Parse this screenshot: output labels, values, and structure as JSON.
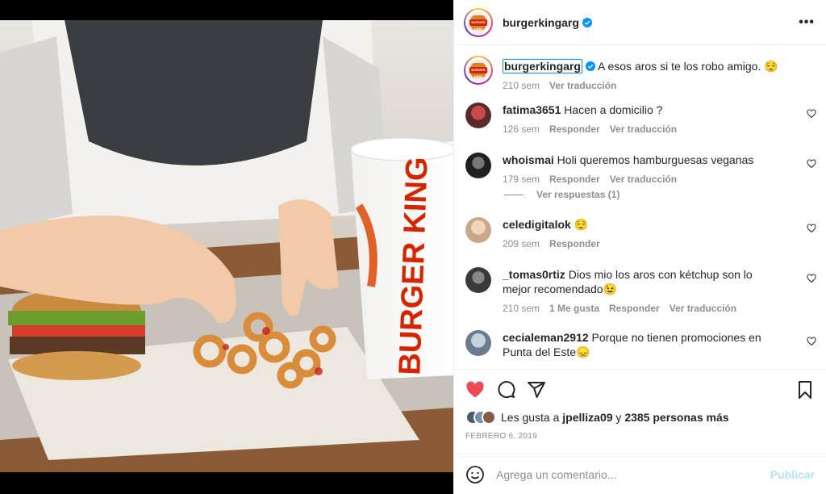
{
  "post": {
    "username": "burgerkingarg",
    "avatar_brand_text": "BURGER KING",
    "more_icon": "•••",
    "media_brand_text": "BURGER KING"
  },
  "caption": {
    "username": "burgerkingarg",
    "text": " A esos aros si te los robo amigo. 😌",
    "time": "210 sem",
    "translate": "Ver traducción"
  },
  "comments": [
    {
      "user": "fatima3651",
      "text": " Hacen a domicilio ?",
      "time": "126 sem",
      "likes": "",
      "reply": "Responder",
      "translate": "Ver traducción",
      "avatar_color": "#5a2a2a"
    },
    {
      "user": "whoismai",
      "text": " Holi queremos hamburguesas veganas",
      "time": "179 sem",
      "likes": "",
      "reply": "Responder",
      "translate": "Ver traducción",
      "avatar_color": "#1f1f1f"
    },
    {
      "user": "celedigitalok",
      "text": " 😌",
      "time": "209 sem",
      "likes": "",
      "reply": "Responder",
      "translate": "",
      "avatar_color": "#c9a88a"
    },
    {
      "user": "_tomas0rtiz",
      "text": " Dios mio los aros con kétchup son lo mejor recomendado😉",
      "time": "210 sem",
      "likes": "1 Me gusta",
      "reply": "Responder",
      "translate": "Ver traducción",
      "avatar_color": "#3a3a3a"
    },
    {
      "user": "cecialeman2912",
      "text": " Porque no tienen promociones en Punta del Este😞",
      "time": "",
      "likes": "",
      "reply": "",
      "translate": "",
      "avatar_color": "#6b7b8e"
    }
  ],
  "replies_toggle": "Ver respuestas (1)",
  "likes": {
    "prefix": "Les gusta a ",
    "user": "jpelliza09",
    "middle": " y ",
    "count": "2385 personas más"
  },
  "date": "FEBRERO 6, 2019",
  "add_comment": {
    "placeholder": "Agrega un comentario...",
    "publish": "Publicar"
  },
  "colors": {
    "like_red": "#ed4956",
    "link_blue": "#0095f6",
    "publish_disabled": "#b2dffc",
    "bk_red": "#d62300"
  }
}
